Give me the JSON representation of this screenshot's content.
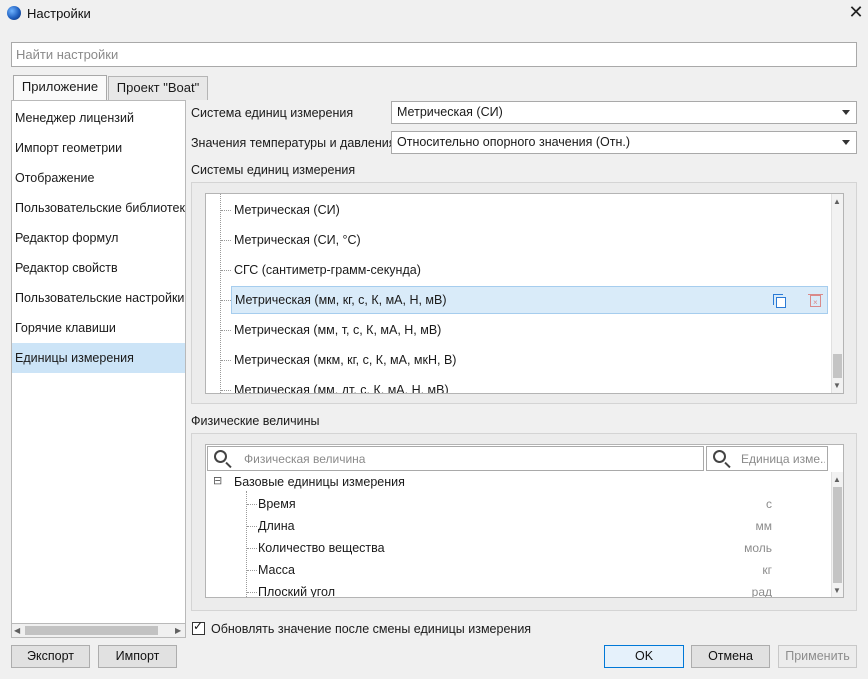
{
  "window": {
    "title": "Настройки",
    "close_glyph": "✕"
  },
  "search": {
    "placeholder": "Найти настройки"
  },
  "tabs": [
    {
      "label": "Приложение",
      "active": true
    },
    {
      "label": "Проект \"Boat\"",
      "active": false
    }
  ],
  "nav": {
    "items": [
      "Менеджер лицензий",
      "Импорт геометрии",
      "Отображение",
      "Пользовательские библиотеки",
      "Редактор формул",
      "Редактор свойств",
      "Пользовательские настройки и",
      "Горячие клавиши",
      "Единицы измерения"
    ],
    "selected": "Единицы измерения"
  },
  "settings": {
    "unit_system_label": "Система единиц измерения",
    "unit_system_value": "Метрическая (СИ)",
    "temp_pressure_label": "Значения температуры и давления",
    "temp_pressure_value": "Относительно опорного значения (Отн.)"
  },
  "unit_systems": {
    "section_label": "Системы единиц измерения",
    "items": [
      "Метрическая (СИ)",
      "Метрическая (СИ, °C)",
      "СГС (сантиметр-грамм-секунда)",
      "Метрическая (мм, кг, с, К, мА, Н, мВ)",
      "Метрическая (мм, т, с, К, мА, Н, мВ)",
      "Метрическая (мкм, кг, с, К, мА, мкН, В)",
      "Метрическая (мм, дт, с, К, мА, Н, мВ)"
    ],
    "selected_index": 3,
    "row_icons": [
      "copy-icon",
      "delete-icon"
    ]
  },
  "quantities": {
    "section_label": "Физические величины",
    "quantity_search_placeholder": "Физическая величина",
    "unit_search_placeholder": "Единица изме...",
    "group": {
      "label": "Базовые единицы измерения",
      "expander": "⊟"
    },
    "rows": [
      {
        "name": "Время",
        "unit": "с"
      },
      {
        "name": "Длина",
        "unit": "мм"
      },
      {
        "name": "Количество вещества",
        "unit": "моль"
      },
      {
        "name": "Масса",
        "unit": "кг"
      },
      {
        "name": "Плоский угол",
        "unit": "рад"
      }
    ]
  },
  "update_checkbox": {
    "label": "Обновлять значение после смены единицы измерения",
    "checked": true,
    "mark": "✓"
  },
  "buttons": {
    "export": "Экспорт",
    "import": "Импорт",
    "ok": "OK",
    "cancel": "Отмена",
    "apply": "Применить"
  },
  "scroll_glyphs": {
    "up": "▲",
    "down": "▼",
    "left": "◀",
    "right": "▶"
  }
}
